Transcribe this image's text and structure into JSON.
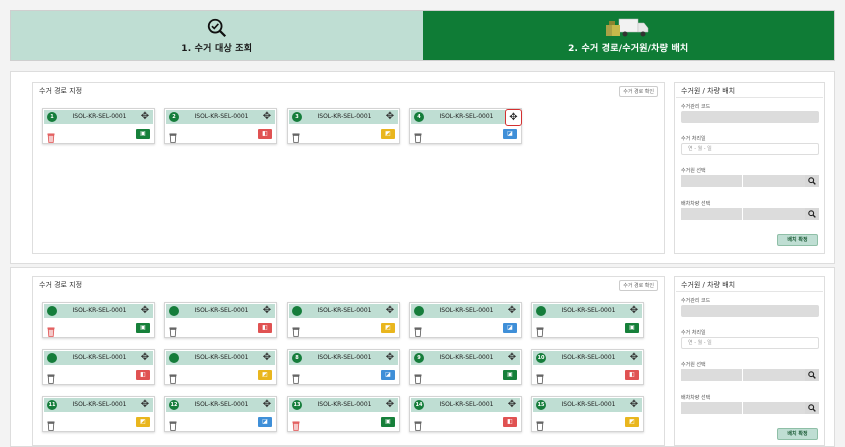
{
  "steps": [
    {
      "label": "1. 수거 대상 조회"
    },
    {
      "label": "2. 수거 경로/수거원/차량 배치"
    }
  ],
  "panel1": {
    "route_title": "수거 경로 지정",
    "route_btn": "수거 경로 확인",
    "cards": [
      {
        "num": "1",
        "code": "ISOL-KR-SEL-0001",
        "trash": "red",
        "tag": "green"
      },
      {
        "num": "2",
        "code": "ISOL-KR-SEL-0001",
        "trash": "outline",
        "tag": "red"
      },
      {
        "num": "3",
        "code": "ISOL-KR-SEL-0001",
        "trash": "outline",
        "tag": "yellow"
      },
      {
        "num": "4",
        "code": "ISOL-KR-SEL-0001",
        "trash": "outline",
        "tag": "blue"
      }
    ],
    "side": {
      "title": "수거원 / 차량 배치",
      "manage_code": "수거관리 코드",
      "date_label": "수거 처리일",
      "date_placeholder": "연 - 월 - 일",
      "worker_label": "수거원 선택",
      "vehicle_label": "배차차량 선택",
      "confirm": "배치 확정"
    }
  },
  "panel2": {
    "route_title": "수거 경로 지정",
    "route_btn": "수거 경로 확인",
    "cards": [
      {
        "num": "",
        "code": "ISOL-KR-SEL-0001",
        "trash": "red",
        "tag": "green"
      },
      {
        "num": "",
        "code": "ISOL-KR-SEL-0001",
        "trash": "outline",
        "tag": "red"
      },
      {
        "num": "",
        "code": "ISOL-KR-SEL-0001",
        "trash": "outline",
        "tag": "yellow"
      },
      {
        "num": "",
        "code": "ISOL-KR-SEL-0001",
        "trash": "outline",
        "tag": "blue"
      },
      {
        "num": "",
        "code": "ISOL-KR-SEL-0001",
        "trash": "outline",
        "tag": "green"
      },
      {
        "num": "",
        "code": "ISOL-KR-SEL-0001",
        "trash": "outline",
        "tag": "red"
      },
      {
        "num": "",
        "code": "ISOL-KR-SEL-0001",
        "trash": "outline",
        "tag": "yellow"
      },
      {
        "num": "8",
        "code": "ISOL-KR-SEL-0001",
        "trash": "outline",
        "tag": "blue"
      },
      {
        "num": "9",
        "code": "ISOL-KR-SEL-0001",
        "trash": "outline",
        "tag": "green"
      },
      {
        "num": "10",
        "code": "ISOL-KR-SEL-0001",
        "trash": "outline",
        "tag": "red"
      },
      {
        "num": "11",
        "code": "ISOL-KR-SEL-0001",
        "trash": "outline",
        "tag": "yellow"
      },
      {
        "num": "12",
        "code": "ISOL-KR-SEL-0001",
        "trash": "outline",
        "tag": "blue"
      },
      {
        "num": "13",
        "code": "ISOL-KR-SEL-0001",
        "trash": "red",
        "tag": "green"
      },
      {
        "num": "14",
        "code": "ISOL-KR-SEL-0001",
        "trash": "outline",
        "tag": "red"
      },
      {
        "num": "15",
        "code": "ISOL-KR-SEL-0001",
        "trash": "outline",
        "tag": "yellow"
      }
    ],
    "side": {
      "title": "수거원 / 차량 배치",
      "manage_code": "수거관리 코드",
      "date_label": "수거 처리일",
      "date_placeholder": "연 - 월 - 일",
      "worker_label": "수거원 선택",
      "vehicle_label": "배차차량 선택",
      "confirm": "배치 확정"
    }
  },
  "colors": {
    "green": "#16803a",
    "red": "#e05252",
    "yellow": "#e9b61e",
    "blue": "#3f8fd8",
    "step1": "#bfded3",
    "step2": "#0f7c36"
  },
  "icons": {
    "search": "magnifier-check-icon",
    "truck": "truck-icon",
    "move": "move-icon",
    "trash": "trash-icon"
  }
}
